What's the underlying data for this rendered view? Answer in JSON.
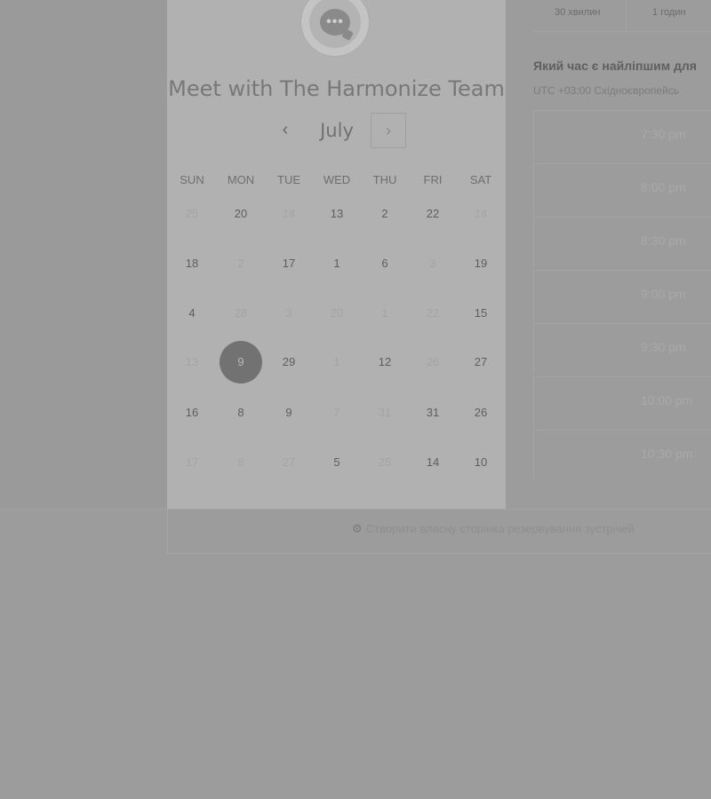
{
  "calendar": {
    "title": "Meet with The Harmonize Team",
    "month": "July",
    "prev_icon": "‹",
    "next_icon": "›",
    "weekdays": [
      "SUN",
      "MON",
      "TUE",
      "WED",
      "THU",
      "FRI",
      "SAT"
    ],
    "weeks": [
      [
        {
          "d": "25",
          "f": true
        },
        {
          "d": "20"
        },
        {
          "d": "14",
          "f": true
        },
        {
          "d": "13"
        },
        {
          "d": "2"
        },
        {
          "d": "22"
        },
        {
          "d": "14",
          "f": true
        }
      ],
      [
        {
          "d": "18"
        },
        {
          "d": "2",
          "f": true
        },
        {
          "d": "17"
        },
        {
          "d": "1"
        },
        {
          "d": "6"
        },
        {
          "d": "3",
          "f": true
        },
        {
          "d": "19"
        }
      ],
      [
        {
          "d": "4"
        },
        {
          "d": "28",
          "f": true
        },
        {
          "d": "3",
          "f": true
        },
        {
          "d": "20",
          "f": true
        },
        {
          "d": "1",
          "f": true
        },
        {
          "d": "22",
          "f": true
        },
        {
          "d": "15"
        }
      ],
      [
        {
          "d": "13",
          "f": true
        },
        {
          "d": "9",
          "s": true
        },
        {
          "d": "29"
        },
        {
          "d": "1",
          "f": true
        },
        {
          "d": "12"
        },
        {
          "d": "26",
          "f": true
        },
        {
          "d": "27"
        }
      ],
      [
        {
          "d": "16"
        },
        {
          "d": "8"
        },
        {
          "d": "9"
        },
        {
          "d": "7",
          "f": true
        },
        {
          "d": "31",
          "f": true
        },
        {
          "d": "31"
        },
        {
          "d": "26"
        }
      ],
      [
        {
          "d": "17",
          "f": true
        },
        {
          "d": "8",
          "f": true
        },
        {
          "d": "27",
          "f": true
        },
        {
          "d": "5"
        },
        {
          "d": "25",
          "f": true
        },
        {
          "d": "14"
        },
        {
          "d": "10"
        }
      ]
    ]
  },
  "durations": [
    "30 хвилин",
    "1 годин"
  ],
  "question": "Який час є найліпшим для",
  "timezone": "UTC +03:00 Східноєвропейсь",
  "time_slots": [
    "7:30 pm",
    "8:00 pm",
    "8:30 pm",
    "9:00 pm",
    "9:30 pm",
    "10:00 pm",
    "10:30 pm"
  ],
  "footer": {
    "icon": "hubspot-sprocket-icon",
    "icon_glyph": "⚙",
    "link_text": "Створити власну сторінка резервування зустрічей"
  }
}
